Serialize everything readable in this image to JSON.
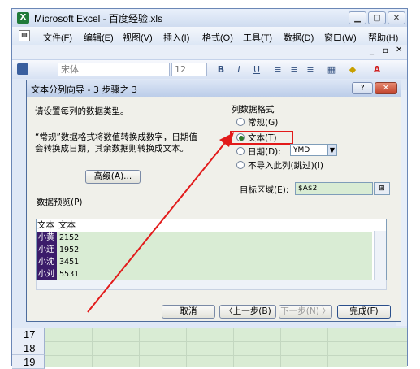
{
  "window": {
    "app_icon": "excel-icon",
    "title": "Microsoft Excel - 百度经验.xls",
    "controls": {
      "minimize": "▁",
      "restore": "▢",
      "close": "✕"
    }
  },
  "menubar": {
    "items": [
      "文件(F)",
      "编辑(E)",
      "视图(V)",
      "插入(I)",
      "格式(O)",
      "工具(T)",
      "数据(D)",
      "窗口(W)",
      "帮助(H)"
    ]
  },
  "toolbar": {
    "font_name": "宋体",
    "font_size": "12",
    "bold": "B",
    "italic": "I",
    "underline": "U"
  },
  "rows": {
    "numbers": [
      "17",
      "18",
      "19"
    ]
  },
  "dialog": {
    "title": "文本分列向导 - 3 步骤之 3",
    "help_label": "?",
    "close_label": "✕",
    "instruction": "请设置每列的数据类型。",
    "description_line1": "“常规”数据格式将数值转换成数字，日期值",
    "description_line2": "会转换成日期，其余数据则转换成文本。",
    "advanced_button": "高级(A)...",
    "column_format": {
      "group_label": "列数据格式",
      "options": [
        {
          "label": "常规(G)",
          "selected": false
        },
        {
          "label": "文本(T)",
          "selected": true
        },
        {
          "label": "日期(D):",
          "selected": false
        },
        {
          "label": "不导入此列(跳过)(I)",
          "selected": false
        }
      ],
      "date_format": "YMD"
    },
    "destination": {
      "label": "目标区域(E):",
      "value": "$A$2"
    },
    "preview": {
      "label": "数据预览(P)",
      "headers": [
        "文本",
        "文本"
      ],
      "rows": [
        {
          "name": "小黄",
          "value": "2152"
        },
        {
          "name": "小连",
          "value": "1952"
        },
        {
          "name": "小沈",
          "value": "3451"
        },
        {
          "name": "小刘",
          "value": "5531"
        }
      ]
    },
    "buttons": {
      "cancel": "取消",
      "back": "〈上一步(B)",
      "next": "下一步(N) 〉",
      "finish": "完成(F)"
    }
  },
  "annotation": {
    "highlight_color": "#e21a1a"
  }
}
